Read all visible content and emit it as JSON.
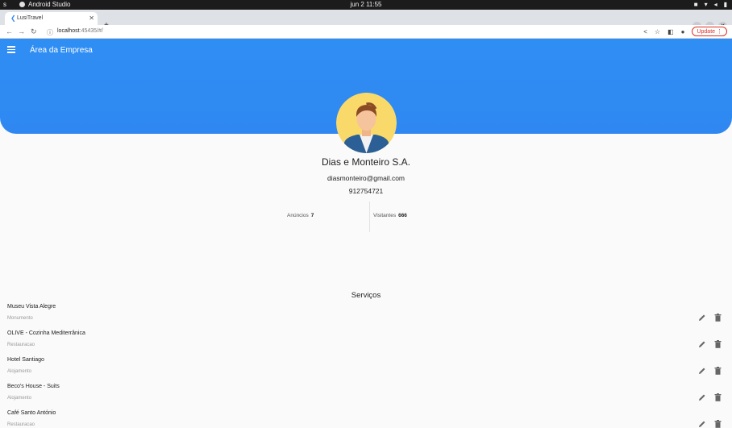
{
  "system_bar": {
    "left": "s",
    "app_name": "Android Studio",
    "clock": "jun 2  11:55"
  },
  "browser": {
    "tab_title": "LusiTravel",
    "url_host": "localhost",
    "url_rest": ":45435/#/",
    "update_label": "Update"
  },
  "app": {
    "title": "Área da Empresa",
    "company_name": "Dias e Monteiro S.A.",
    "email": "diasmonteiro@gmail.com",
    "phone": "912754721",
    "stats": {
      "ads_label": "Anúncios",
      "ads_value": "7",
      "visitors_label": "Visitantes",
      "visitors_value": "666"
    },
    "services_title": "Serviços",
    "services": [
      {
        "name": "Museu Vista Alegre",
        "category": "Monumento"
      },
      {
        "name": "OLIVE - Cozinha Mediterrânica",
        "category": "Restauracao"
      },
      {
        "name": "Hotel Santiago",
        "category": "Alojamento"
      },
      {
        "name": "Beco's House - Suits",
        "category": "Alojamento"
      },
      {
        "name": "Café Santo António",
        "category": "Restauracao"
      }
    ]
  },
  "colors": {
    "header_blue": "#2f8ef4",
    "update_red": "#d93025"
  }
}
